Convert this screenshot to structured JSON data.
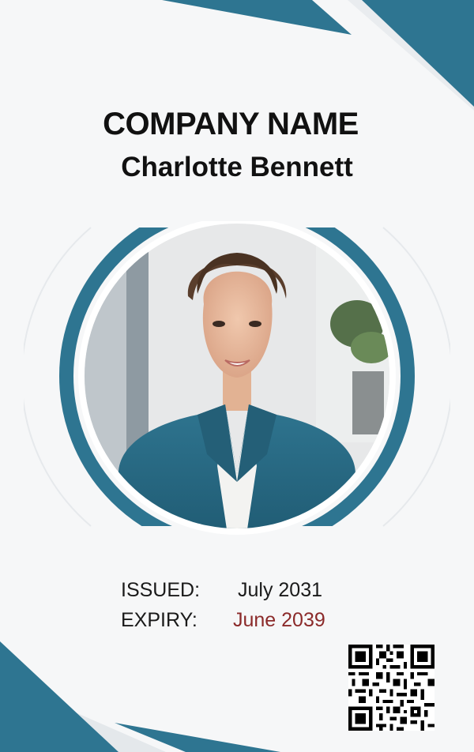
{
  "card": {
    "company_name": "COMPANY NAME",
    "person_name": "Charlotte Bennett",
    "issued_label": "ISSUED:",
    "issued_value": "July 2031",
    "expiry_label": "EXPIRY:",
    "expiry_value": "June 2039"
  },
  "photo": {
    "subject": "smiling woman with hair pulled back, teal blazer over white top, blurred office background"
  },
  "colors": {
    "accent_teal": "#2e7591",
    "background": "#f6f7f8",
    "expiry_text": "#8b2a2a",
    "text": "#111111"
  },
  "icons": {
    "qr_code": "qr-code-icon"
  }
}
